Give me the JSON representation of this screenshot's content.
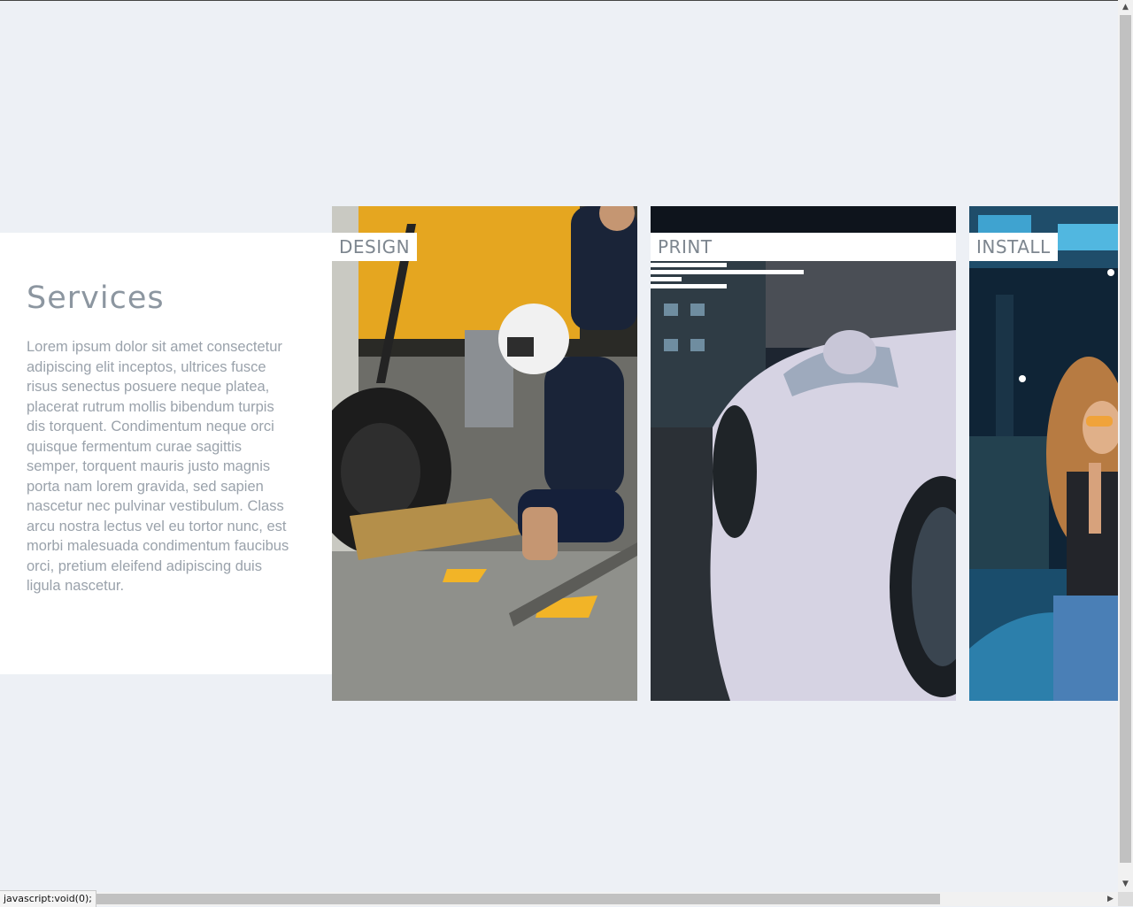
{
  "services": {
    "title": "Services",
    "body": "Lorem ipsum dolor sit amet consectetur adipiscing elit inceptos, ultrices fusce risus senectus posuere neque platea, placerat rutrum mollis bibendum turpis dis torquent. Condimentum neque orci quisque fermentum curae sagittis semper, torquent mauris justo magnis porta nam lorem gravida, sed sapien nascetur nec pulvinar vestibulum. Class arcu nostra lectus vel eu tortor nunc, est morbi malesuada condimentum faucibus orci, pretium eleifend adipiscing duis ligula nascetur."
  },
  "cards": [
    {
      "label": "DESIGN",
      "photo": "pit-crew-racing-photo"
    },
    {
      "label": "PRINT",
      "photo": "white-sports-car-photo"
    },
    {
      "label": "INSTALL",
      "photo": "woman-neon-street-photo"
    }
  ],
  "status_bar": {
    "text": "javascript:void(0);"
  },
  "colors": {
    "page_background": "#edf0f5",
    "panel_background": "#ffffff",
    "title_text": "#8c96a0",
    "body_text": "#9aa2ab",
    "label_text": "#7d868f"
  }
}
